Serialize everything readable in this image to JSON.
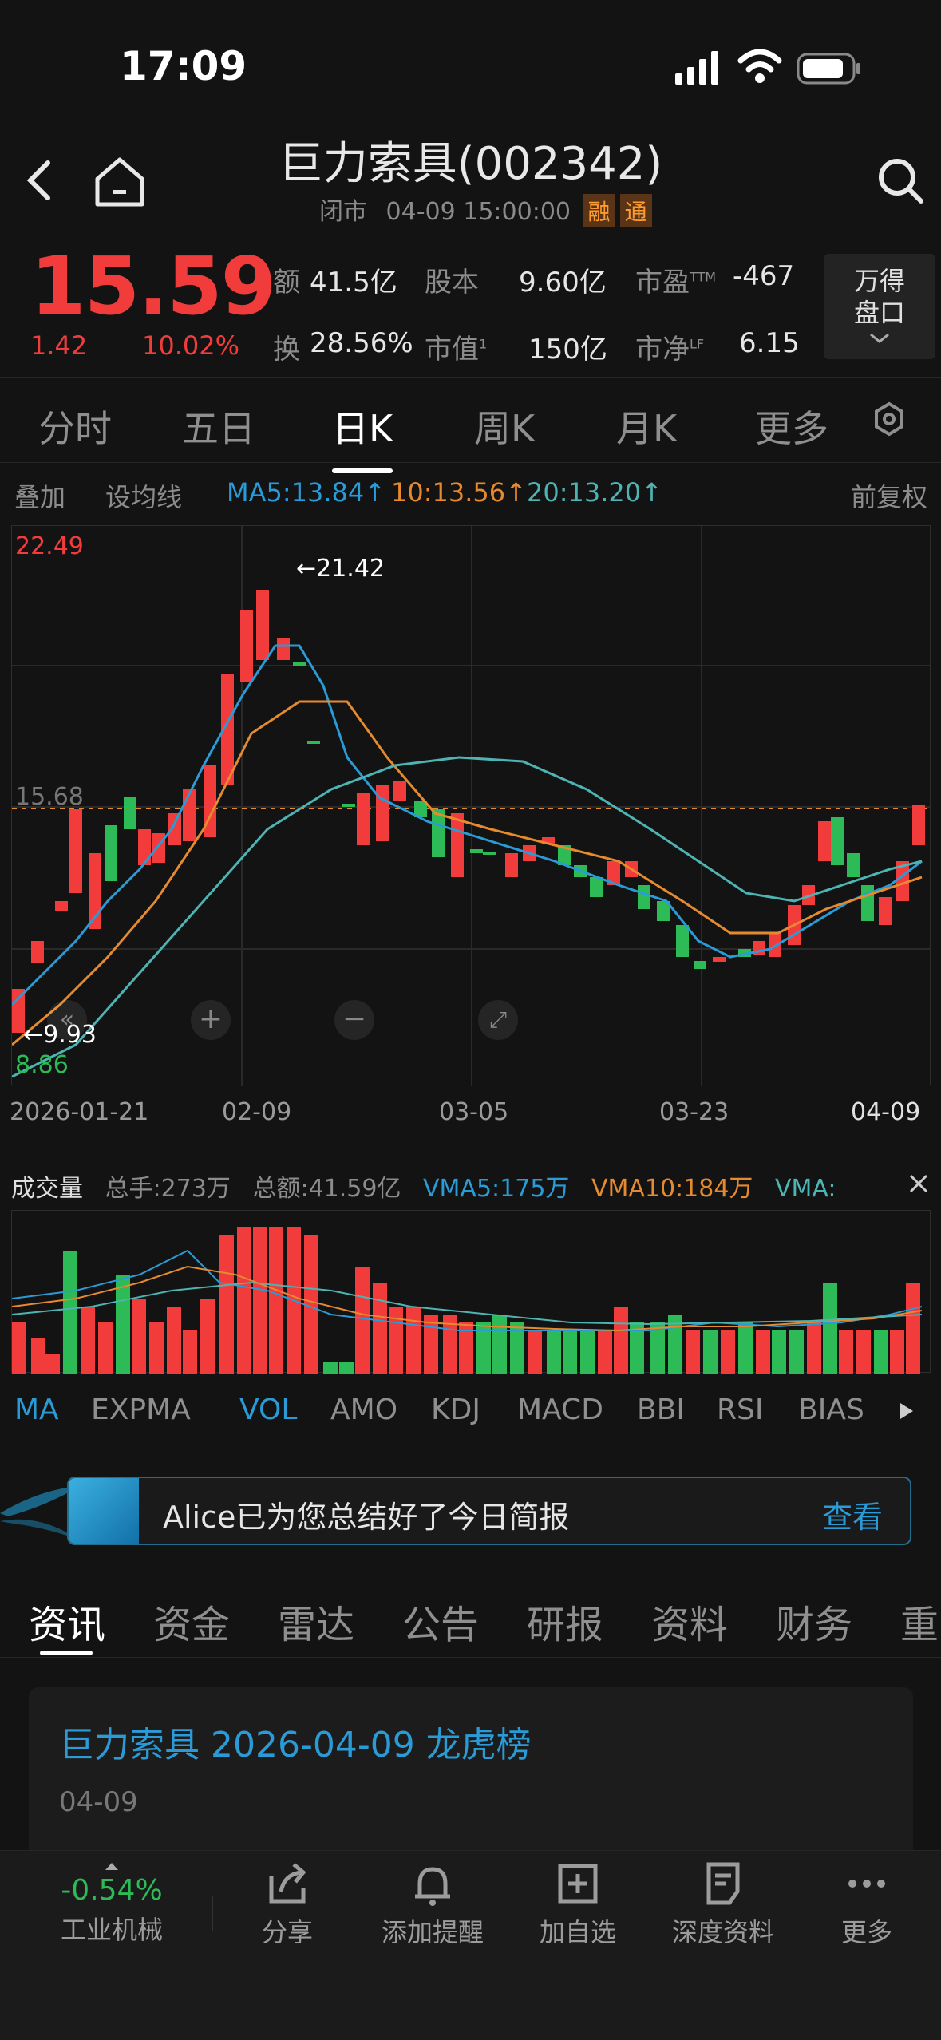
{
  "status": {
    "time": "17:09"
  },
  "header": {
    "title": "巨力索具(002342)",
    "status": "闭市",
    "datetime": "04-09 15:00:00",
    "tag1": "融",
    "tag2": "通"
  },
  "quote": {
    "price": "15.59",
    "change": "1.42",
    "change_pct": "10.02%",
    "amount_label": "额",
    "amount": "41.5亿",
    "shares_label": "股本",
    "shares": "9.60亿",
    "pe_label": "市盈",
    "pe_sup": "TTM",
    "pe": "-467",
    "turnover_label": "换",
    "turnover": "28.56%",
    "mcap_label": "市值",
    "mcap_sup": "1",
    "mcap": "150亿",
    "pb_label": "市净",
    "pb_sup": "LF",
    "pb": "6.15",
    "panel_btn": "万得\n盘口"
  },
  "tabs": [
    "分时",
    "五日",
    "日K",
    "周K",
    "月K",
    "更多"
  ],
  "ma_row": {
    "overlay": "叠加",
    "set_ma": "设均线",
    "ma5": "MA5:13.84↑",
    "ma10": "10:13.56↑",
    "ma20": "20:13.20↑",
    "adjust": "前复权"
  },
  "kchart": {
    "high_label": "22.49",
    "low_label": "8.86",
    "ref_label": "15.68",
    "max_mark": "←21.42",
    "min_mark": "←9.93",
    "dates": [
      "2026-01-21",
      "02-09",
      "03-05",
      "03-23",
      "04-09"
    ]
  },
  "volume": {
    "title": "成交量",
    "total_hands": "总手:273万",
    "total_amount": "总额:41.59亿",
    "vma5": "VMA5:175万",
    "vma10": "VMA10:184万",
    "vma_more": "VMA:"
  },
  "indicators": [
    "MA",
    "EXPMA",
    "VOL",
    "AMO",
    "KDJ",
    "MACD",
    "BBI",
    "RSI",
    "BIAS"
  ],
  "banner": {
    "text": "Alice已为您总结好了今日简报",
    "action": "查看"
  },
  "news_tabs": [
    "资讯",
    "资金",
    "雷达",
    "公告",
    "研报",
    "资料",
    "财务",
    "重"
  ],
  "news_card": {
    "title": "巨力索具 2026-04-09 龙虎榜",
    "date": "04-09"
  },
  "bottom": {
    "sector_pct": "-0.54%",
    "sector": "工业机械",
    "share": "分享",
    "alert": "添加提醒",
    "watch": "加自选",
    "deep": "深度资料",
    "more": "更多"
  },
  "colors": {
    "up": "#f23c3c",
    "down": "#2dbb57",
    "ma5": "#2a9bd6",
    "ma10": "#e58a2e",
    "ma20": "#4db3b3",
    "accent": "#2a9bd6"
  }
}
